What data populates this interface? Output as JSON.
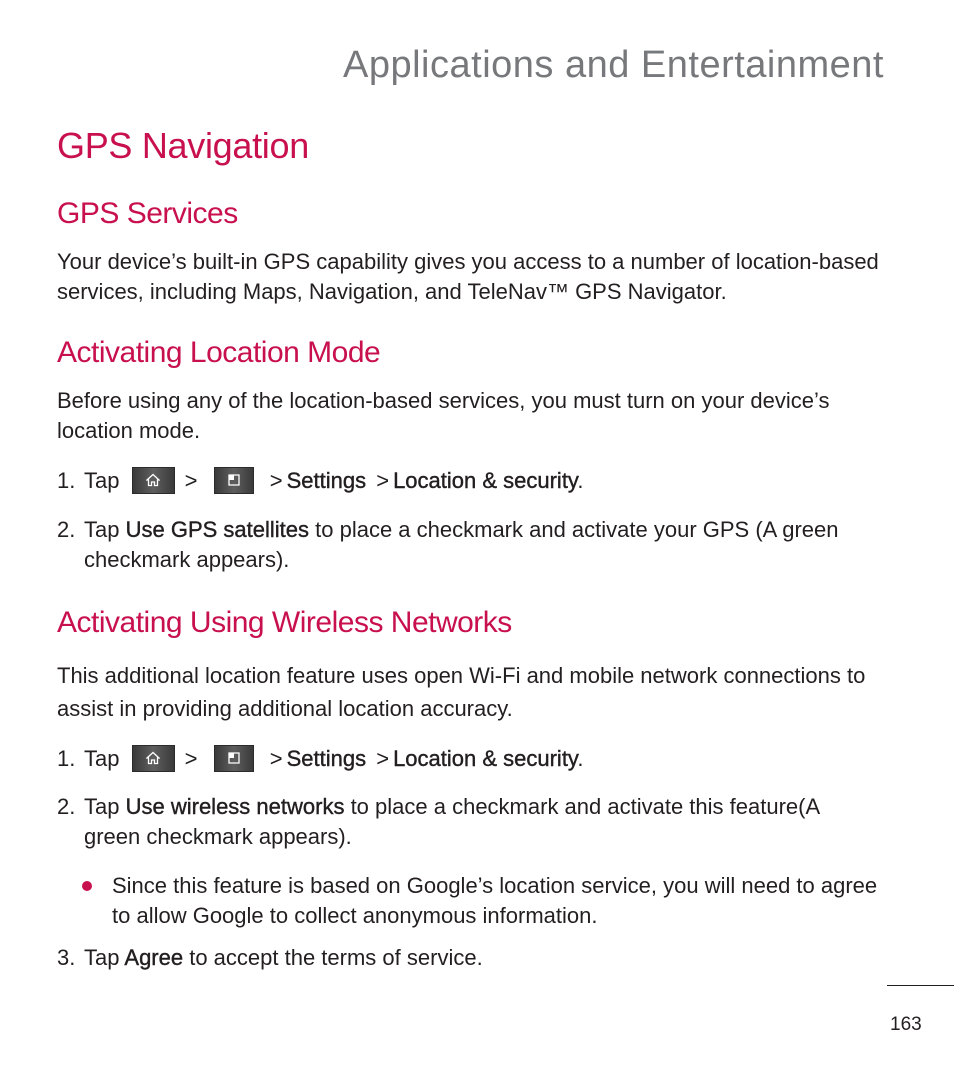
{
  "header": {
    "chapter_title": "Applications and Entertainment"
  },
  "page_title": "GPS Navigation",
  "sections": {
    "gps_services": {
      "heading": "GPS Services",
      "body": "Your device’s built-in GPS capability gives you access to a number of location-based services, including Maps, Navigation, and TeleNav™ GPS Navigator."
    },
    "location_mode": {
      "heading": "Activating Location Mode",
      "body": "Before using any of the location-based services, you must turn on your device’s location mode.",
      "steps": [
        {
          "num": "1.",
          "tap": "Tap",
          "key1_icon": "home-key-icon",
          "sep": ">",
          "key2_icon": "menu-key-icon",
          "settings": "Settings",
          "location": "Location & security",
          "end": "."
        },
        {
          "num": "2.",
          "tap": "Tap",
          "bold": "Use GPS satellites",
          "rest": " to place a checkmark and activate your GPS (A green",
          "cont": "checkmark appears)."
        }
      ]
    },
    "wireless": {
      "heading": "Activating Using Wireless Networks",
      "body": "This additional location feature uses open Wi-Fi and mobile network connections to assist in providing additional location accuracy.",
      "steps": [
        {
          "num": "1.",
          "tap": "Tap",
          "key1_icon": "home-key-icon",
          "sep": ">",
          "key2_icon": "menu-key-icon",
          "settings": "Settings",
          "location": "Location & security",
          "end": "."
        },
        {
          "num": "2.",
          "tap": "Tap",
          "bold": "Use wireless networks",
          "rest": " to place a checkmark and activate this feature(A",
          "cont": "green checkmark appears)."
        },
        {
          "num": "3.",
          "tap": "Tap",
          "bold": "Agree",
          "rest": " to accept the terms of service."
        }
      ],
      "bullet": "Since this feature is based on Google’s location service, you will need to agree to allow Google to collect anonymous information."
    }
  },
  "footer": {
    "page_number": "163"
  },
  "colors": {
    "accent": "#c8104e",
    "chapter_gray": "#77787b",
    "text": "#231f20"
  }
}
